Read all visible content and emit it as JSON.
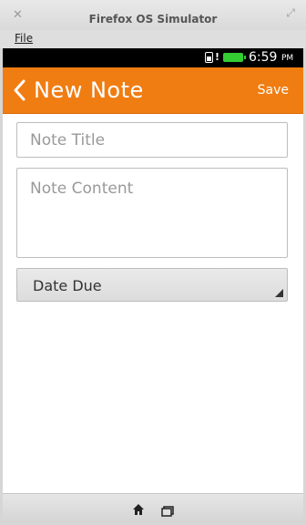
{
  "window": {
    "title": "Firefox OS Simulator",
    "close_icon": "close-icon",
    "maximize_icon": "maximize-icon"
  },
  "menubar": {
    "file_label": "File"
  },
  "statusbar": {
    "sim_icon": "sim-card-icon",
    "alert": "!",
    "battery_icon": "battery-icon",
    "battery_color": "#33cc33",
    "time": "6:59",
    "ampm": "PM"
  },
  "header": {
    "back_icon": "back-chevron-icon",
    "title": "New Note",
    "save_label": "Save",
    "color": "#f07d12"
  },
  "form": {
    "title_placeholder": "Note Title",
    "content_placeholder": "Note Content",
    "date_label": "Date Due",
    "dropdown_icon": "dropdown-arrow-icon"
  },
  "toolbar": {
    "home_icon": "home-icon",
    "windows_icon": "windows-icon"
  }
}
